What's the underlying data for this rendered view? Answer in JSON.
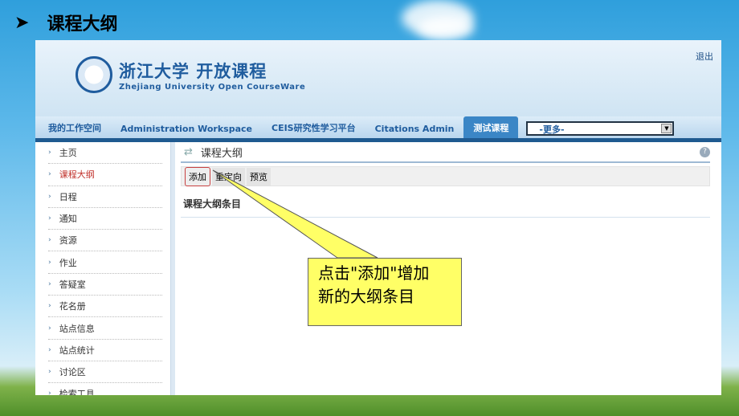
{
  "slide": {
    "bullet": "➤",
    "title": "课程大纲"
  },
  "header": {
    "logo_cn": "浙江大学 开放课程",
    "logo_en": "Zhejiang University Open CourseWare",
    "logout": "退出"
  },
  "nav": {
    "items": [
      "我的工作空间",
      "Administration Workspace",
      "CEIS研究性学习平台",
      "Citations Admin"
    ],
    "active": "测试课程",
    "more_select": "-更多-"
  },
  "sidebar": {
    "items": [
      "主页",
      "课程大纲",
      "日程",
      "通知",
      "资源",
      "作业",
      "答疑室",
      "花名册",
      "站点信息",
      "站点统计",
      "讨论区",
      "检索工具"
    ],
    "current": "课程大纲"
  },
  "main": {
    "title": "课程大纲",
    "toolbar": [
      "添加",
      "重定向",
      "预览"
    ],
    "section": "课程大纲条目"
  },
  "callout": {
    "text_line1": "点击\"添加\"增加",
    "text_line2": "新的大纲条目"
  },
  "colors": {
    "accent": "#1f5c9e",
    "callout": "#ffff66",
    "active_tab": "#3b86c6"
  }
}
